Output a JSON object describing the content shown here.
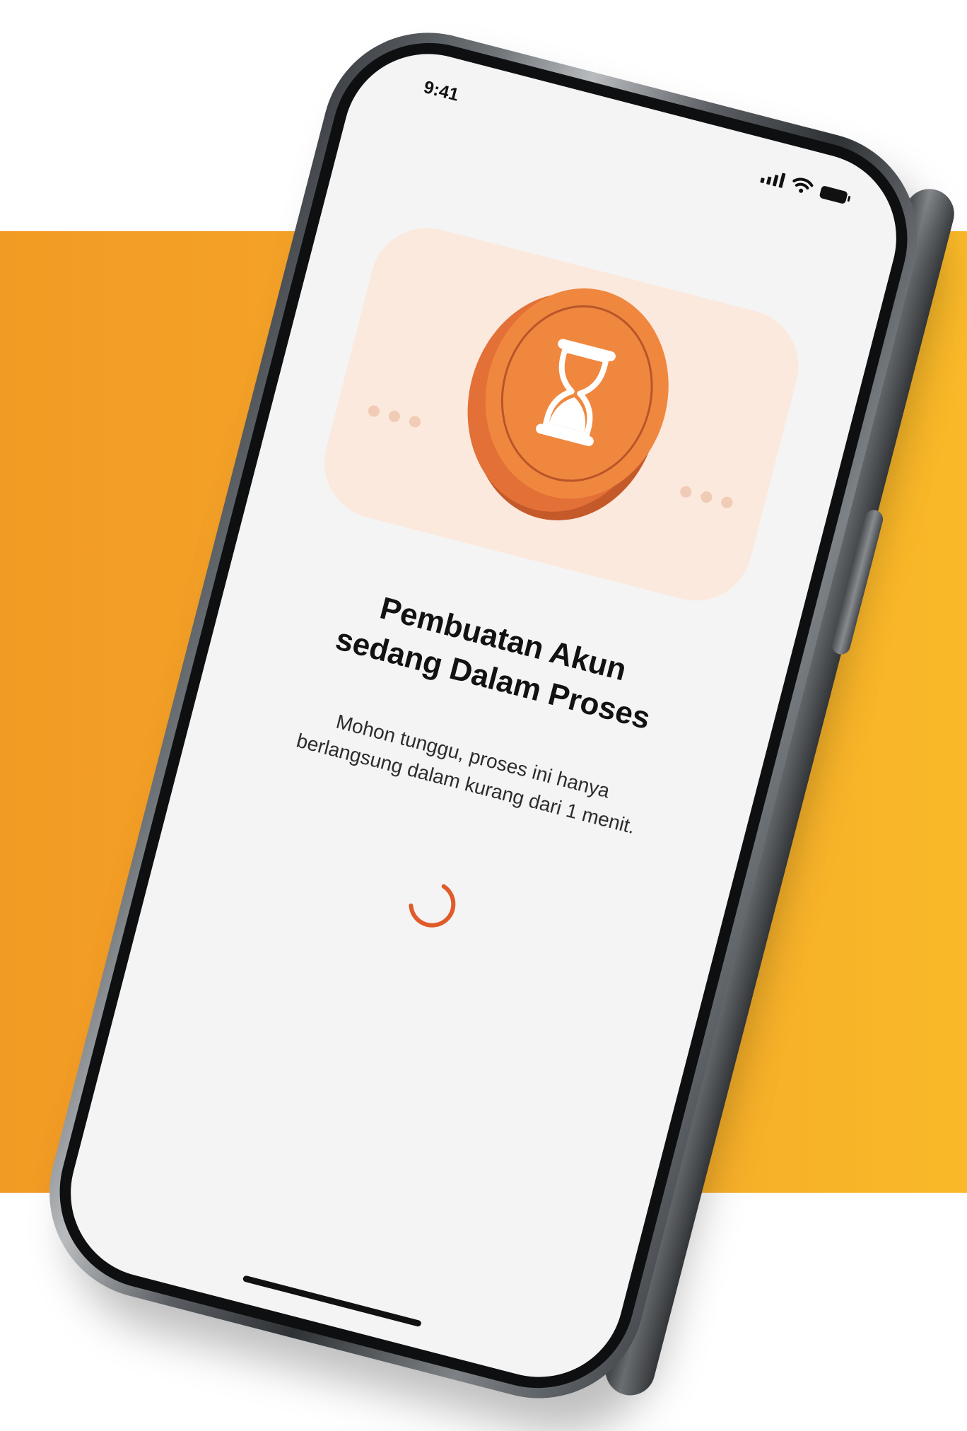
{
  "status_bar": {
    "time": "9:41",
    "signal_icon": "cellular-signal-icon",
    "wifi_icon": "wifi-icon",
    "battery_icon": "battery-icon"
  },
  "illustration": {
    "icon": "hourglass-coin-icon"
  },
  "content": {
    "title_line1": "Pembuatan Akun",
    "title_line2": "sedang Dalam Proses",
    "subtitle_line1": "Mohon tunggu, proses ini hanya",
    "subtitle_line2": "berlangsung dalam kurang dari 1 menit."
  },
  "loader": {
    "icon": "loading-spinner-icon",
    "color": "#e05a2a"
  },
  "colors": {
    "band_left": "#f29b24",
    "band_right": "#f9b928",
    "coin": "#f0873f",
    "illustration_bg": "#fbe9de",
    "screen_bg": "#f4f4f4"
  }
}
